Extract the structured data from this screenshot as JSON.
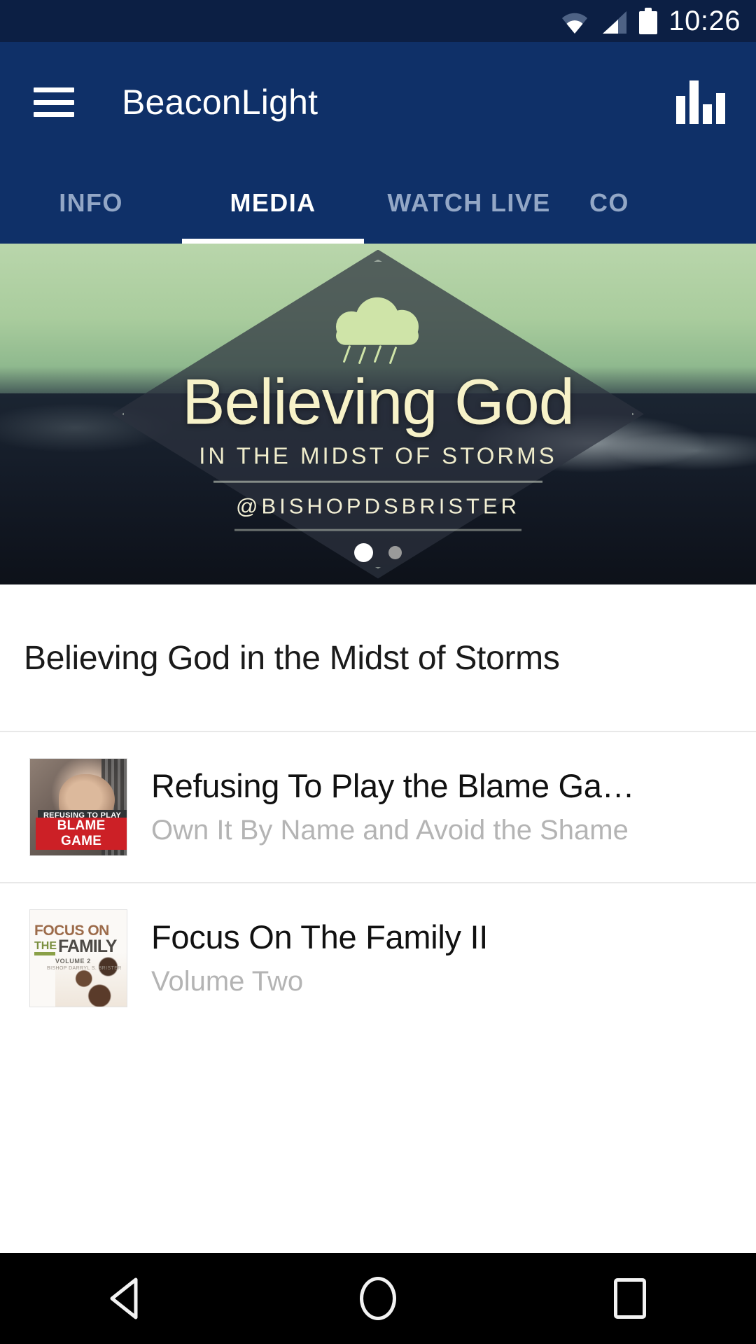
{
  "status_bar": {
    "time": "10:26",
    "icons": [
      "wifi-icon",
      "cellular-signal-icon",
      "battery-icon"
    ]
  },
  "app_bar": {
    "title": "BeaconLight",
    "menu_icon": "hamburger-menu-icon",
    "action_icon": "equalizer-bars-icon",
    "background_color": "#0f3068"
  },
  "tabs": [
    {
      "label": "INFO",
      "active": false
    },
    {
      "label": "MEDIA",
      "active": true
    },
    {
      "label": "WATCH LIVE",
      "active": false
    },
    {
      "label": "CO",
      "active": false
    }
  ],
  "hero": {
    "title": "Believing God",
    "subtitle": "IN THE MIDST OF STORMS",
    "handle": "@BISHOPDSBRISTER",
    "icon": "rain-cloud-icon",
    "carousel": {
      "total": 2,
      "active_index": 0
    }
  },
  "content": {
    "section_title": "Believing God in the Midst of Storms",
    "media_items": [
      {
        "title": "Refusing To Play the Blame Ga…",
        "subtitle": "Own It By Name and Avoid the Shame",
        "thumb_line1": "REFUSING TO PLAY THE",
        "thumb_line2": "BLAME GAME"
      },
      {
        "title": "Focus On The Family II",
        "subtitle": "Volume Two",
        "thumb_line1": "FOCUS ON",
        "thumb_the": "THE",
        "thumb_family": "FAMILY",
        "thumb_volume": "VOLUME 2",
        "thumb_byline": "BISHOP DARRYL S. BRISTER"
      }
    ]
  },
  "nav_bar": {
    "back": "back-triangle-icon",
    "home": "home-circle-icon",
    "recents": "recents-square-icon"
  }
}
